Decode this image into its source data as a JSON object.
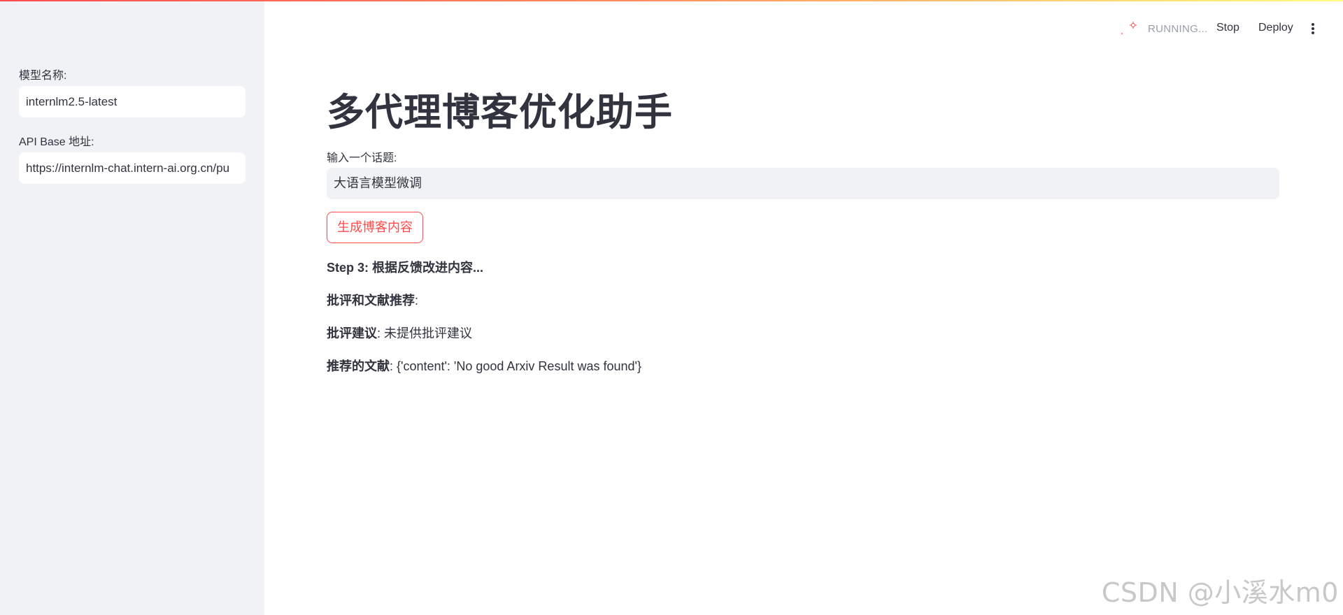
{
  "sidebar": {
    "model_label": "模型名称:",
    "model_value": "internlm2.5-latest",
    "api_label": "API Base 地址:",
    "api_value": "https://internlm-chat.intern-ai.org.cn/pu"
  },
  "header": {
    "status": "RUNNING...",
    "stop_label": "Stop",
    "deploy_label": "Deploy"
  },
  "main": {
    "title": "多代理博客优化助手",
    "topic_label": "输入一个话题:",
    "topic_value": "大语言模型微调",
    "generate_label": "生成博客内容",
    "step_text": "Step 3: 根据反馈改进内容...",
    "section_heading": "批评和文献推荐",
    "critique_key": "批评建议",
    "critique_value": ": 未提供批评建议",
    "refs_key": "推荐的文献",
    "refs_value": ": {'content': 'No good Arxiv Result was found'}"
  },
  "watermark": "CSDN @小溪水m0",
  "colors": {
    "accent": "#ff4b4b",
    "sidebar_bg": "#f0f2f6",
    "text": "#31333f"
  }
}
